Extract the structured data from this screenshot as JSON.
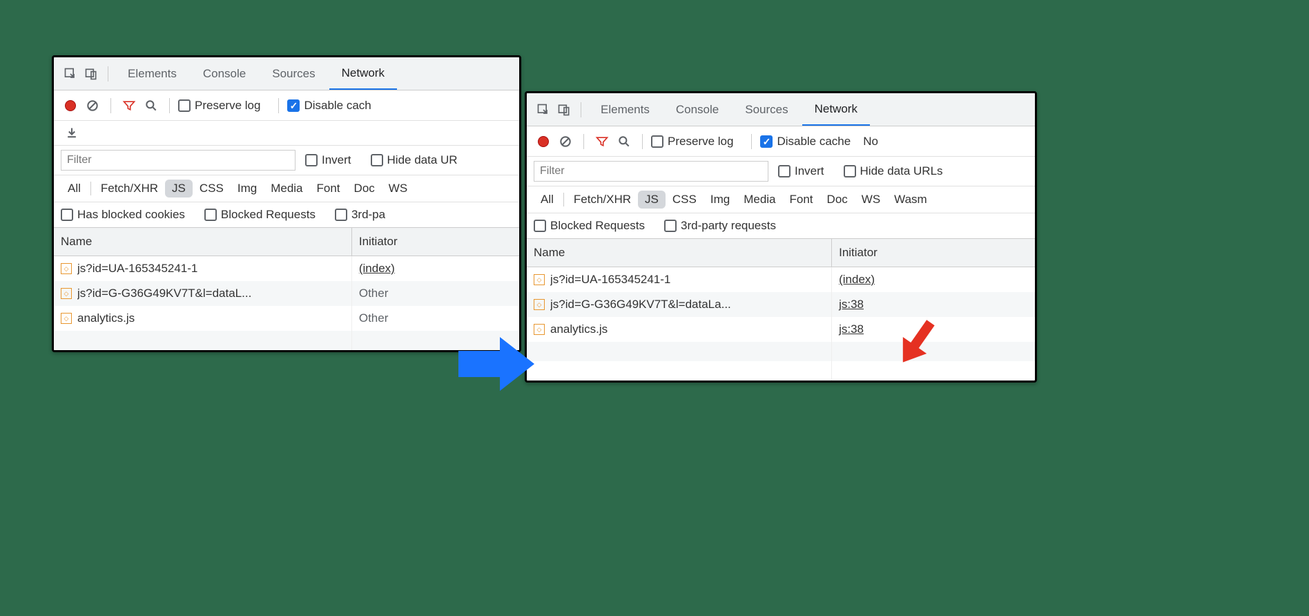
{
  "tabs": {
    "elements": "Elements",
    "console": "Console",
    "sources": "Sources",
    "network": "Network"
  },
  "toolbar": {
    "preserve_log": "Preserve log",
    "disable_cache_left": "Disable cach",
    "disable_cache_right": "Disable cache",
    "no_label": "No"
  },
  "filter": {
    "placeholder": "Filter",
    "invert": "Invert",
    "hide_data_urls_left": "Hide data UR",
    "hide_data_urls_right": "Hide data URLs"
  },
  "types": {
    "all": "All",
    "fetch_xhr": "Fetch/XHR",
    "js": "JS",
    "css": "CSS",
    "img": "Img",
    "media": "Media",
    "font": "Font",
    "doc": "Doc",
    "ws": "WS",
    "wasm": "Wasm"
  },
  "extra": {
    "has_blocked_cookies": "Has blocked cookies",
    "blocked_requests": "Blocked Requests",
    "third_party_left": "3rd-pa",
    "third_party_right": "3rd-party requests"
  },
  "columns": {
    "name": "Name",
    "initiator": "Initiator"
  },
  "left_rows": [
    {
      "name": "js?id=UA-165345241-1",
      "initiator": "(index)",
      "link": true
    },
    {
      "name": "js?id=G-G36G49KV7T&l=dataL...",
      "initiator": "Other",
      "link": false
    },
    {
      "name": "analytics.js",
      "initiator": "Other",
      "link": false
    }
  ],
  "right_rows": [
    {
      "name": "js?id=UA-165345241-1",
      "initiator": "(index)",
      "link": true
    },
    {
      "name": "js?id=G-G36G49KV7T&l=dataLa...",
      "initiator": "js:38",
      "link": true
    },
    {
      "name": "analytics.js",
      "initiator": "js:38",
      "link": true
    }
  ]
}
